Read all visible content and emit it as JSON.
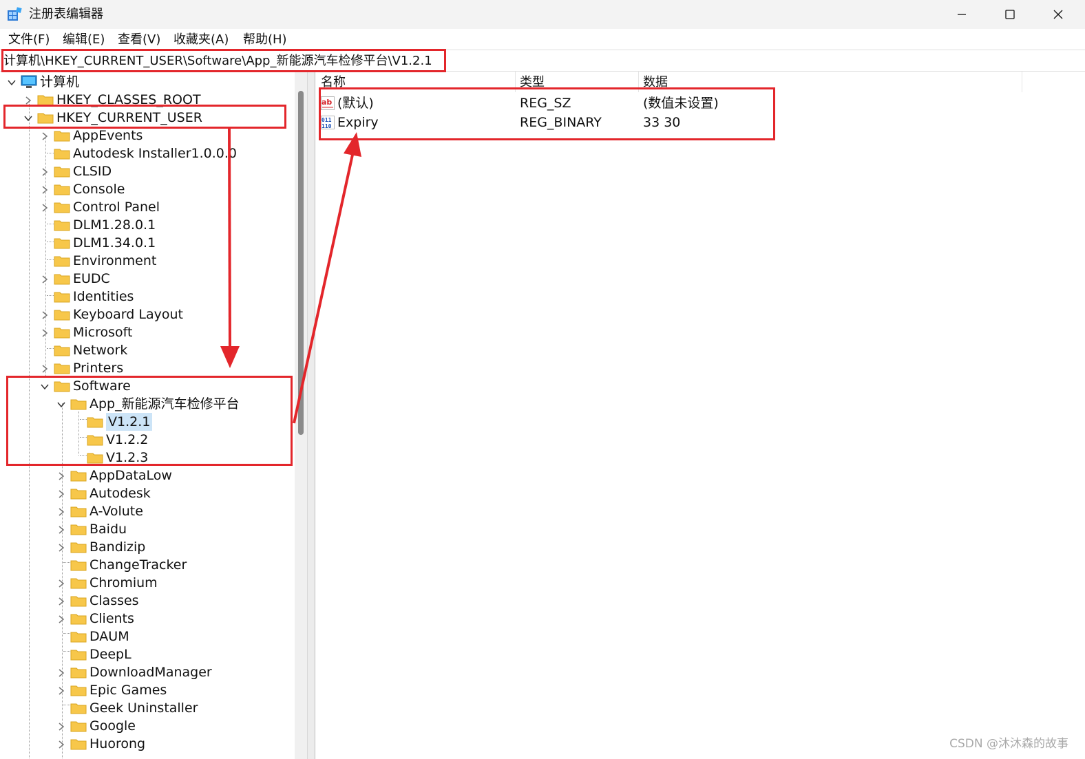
{
  "window": {
    "title": "注册表编辑器",
    "controls": {
      "minimize": "─",
      "maximize": "☐",
      "close": "✕"
    }
  },
  "menu": [
    "文件(F)",
    "编辑(E)",
    "查看(V)",
    "收藏夹(A)",
    "帮助(H)"
  ],
  "address": "计算机\\HKEY_CURRENT_USER\\Software\\App_新能源汽车检修平台\\V1.2.1",
  "tree": {
    "root": "计算机",
    "hives": [
      "HKEY_CLASSES_ROOT",
      "HKEY_CURRENT_USER"
    ],
    "hkcu_children": [
      "AppEvents",
      "Autodesk Installer1.0.0.0",
      "CLSID",
      "Console",
      "Control Panel",
      "DLM1.28.0.1",
      "DLM1.34.0.1",
      "Environment",
      "EUDC",
      "Identities",
      "Keyboard Layout",
      "Microsoft",
      "Network",
      "Printers",
      "Software"
    ],
    "software_children_top": [
      "App_新能源汽车检修平台"
    ],
    "app_children": [
      "V1.2.1",
      "V1.2.2",
      "V1.2.3"
    ],
    "software_children_rest": [
      "AppDataLow",
      "Autodesk",
      "A-Volute",
      "Baidu",
      "Bandizip",
      "ChangeTracker",
      "Chromium",
      "Classes",
      "Clients",
      "DAUM",
      "DeepL",
      "DownloadManager",
      "Epic Games",
      "Geek Uninstaller",
      "Google",
      "Huorong"
    ],
    "selected": "V1.2.1"
  },
  "list": {
    "columns": [
      "名称",
      "类型",
      "数据"
    ],
    "rows": [
      {
        "name": "(默认)",
        "type": "REG_SZ",
        "data": "(数值未设置)",
        "icon": "string-value-icon"
      },
      {
        "name": "Expiry",
        "type": "REG_BINARY",
        "data": "33 30",
        "icon": "binary-value-icon"
      }
    ]
  },
  "watermark": "CSDN @沐沐森的故事",
  "colors": {
    "annotation_red": "#e3262b",
    "selection": "#cce4f7",
    "folder": "#f7c74a"
  }
}
